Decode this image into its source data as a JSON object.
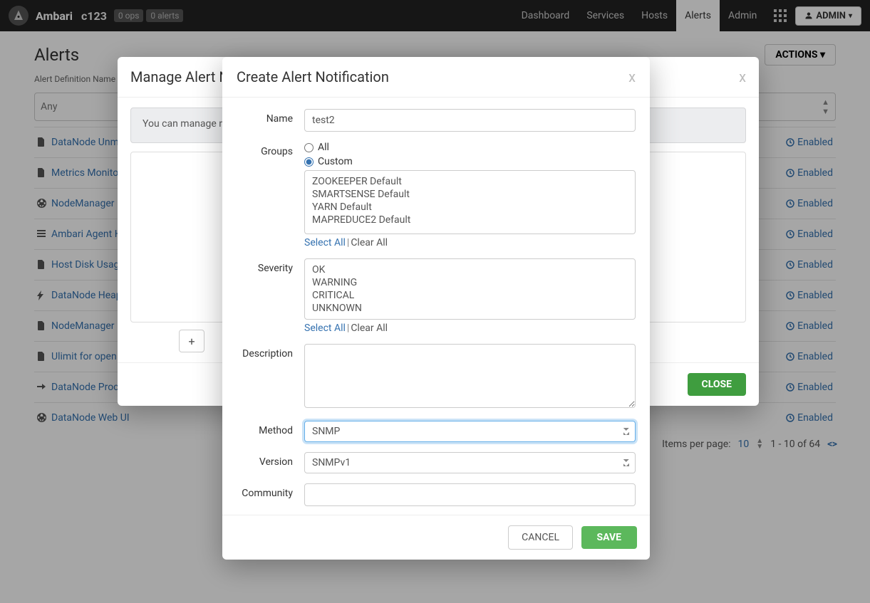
{
  "nav": {
    "brand": "Ambari",
    "cluster": "c123",
    "ops_badge": "0 ops",
    "alerts_badge": "0 alerts",
    "items": [
      "Dashboard",
      "Services",
      "Hosts",
      "Alerts",
      "Admin"
    ],
    "active": "Alerts",
    "admin_btn": "ADMIN"
  },
  "page": {
    "title": "Alerts",
    "actions_btn": "ACTIONS",
    "filter_label": "Alert Definition Name",
    "filter_value": "Any",
    "alerts": [
      {
        "name": "DataNode Unm",
        "icon": "doc"
      },
      {
        "name": "Metrics Monitor",
        "icon": "doc"
      },
      {
        "name": "NodeManager",
        "icon": "globe"
      },
      {
        "name": "Ambari Agent H",
        "icon": "bars"
      },
      {
        "name": "Host Disk Usag",
        "icon": "doc"
      },
      {
        "name": "DataNode Heap",
        "icon": "bolt"
      },
      {
        "name": "NodeManager",
        "icon": "doc"
      },
      {
        "name": "Ulimit for open",
        "icon": "doc"
      },
      {
        "name": "DataNode Proc",
        "icon": "arrow"
      },
      {
        "name": "DataNode Web UI",
        "icon": "globe"
      }
    ],
    "enabled_label": "Enabled",
    "pager": {
      "label": "Items per page:",
      "size": "10",
      "range": "1 - 10 of 64"
    }
  },
  "modal1": {
    "title": "Manage Alert No",
    "info": "You can manage no",
    "close_btn": "CLOSE"
  },
  "modal2": {
    "title": "Create Alert Notification",
    "labels": {
      "name": "Name",
      "groups": "Groups",
      "severity": "Severity",
      "description": "Description",
      "method": "Method",
      "version": "Version",
      "community": "Community"
    },
    "name_value": "test2",
    "groups_radios": {
      "all": "All",
      "custom": "Custom"
    },
    "groups_checked": "custom",
    "groups_options": [
      "ZOOKEEPER Default",
      "SMARTSENSE Default",
      "YARN Default",
      "MAPREDUCE2 Default"
    ],
    "select_all": "Select All",
    "clear_all": "Clear All",
    "severity_options": [
      "OK",
      "WARNING",
      "CRITICAL",
      "UNKNOWN"
    ],
    "method_value": "SNMP",
    "version_value": "SNMPv1",
    "cancel_btn": "CANCEL",
    "save_btn": "SAVE"
  }
}
